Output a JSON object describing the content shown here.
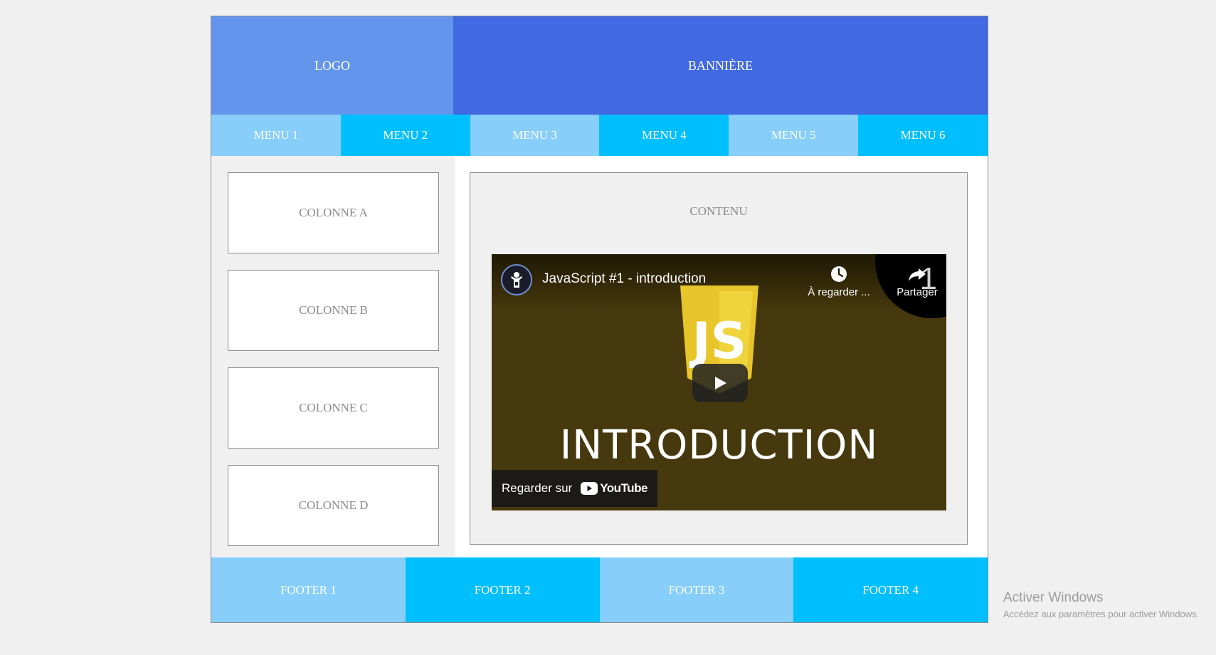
{
  "header": {
    "logo": "LOGO",
    "banner": "BANNIÈRE"
  },
  "menu": {
    "items": [
      "MENU 1",
      "MENU 2",
      "MENU 3",
      "MENU 4",
      "MENU 5",
      "MENU 6"
    ]
  },
  "sidebar": {
    "columns": [
      "COLONNE A",
      "COLONNE B",
      "COLONNE C",
      "COLONNE D"
    ]
  },
  "content": {
    "title": "CONTENU",
    "video": {
      "title": "JavaScript #1 - introduction",
      "watch_later": "À regarder ...",
      "share": "Partager",
      "corner_number": "1",
      "logo_text": "JS",
      "big_text": "INTRODUCTION",
      "watch_on": "Regarder sur",
      "youtube": "YouTube",
      "channel_avatar_icon": "channel-avatar-icon",
      "play_icon": "play-icon"
    }
  },
  "footer": {
    "items": [
      "FOOTER 1",
      "FOOTER 2",
      "FOOTER 3",
      "FOOTER 4"
    ]
  },
  "watermark": {
    "title": "Activer Windows",
    "subtitle": "Accédez aux paramètres pour activer Windows."
  },
  "colors": {
    "logo_bg": "#6495ed",
    "banner_bg": "#4169e1",
    "menu_light": "#87cefa",
    "menu_dark": "#00bfff",
    "video_bg": "#47390e",
    "js_yellow": "#e8c52a"
  }
}
